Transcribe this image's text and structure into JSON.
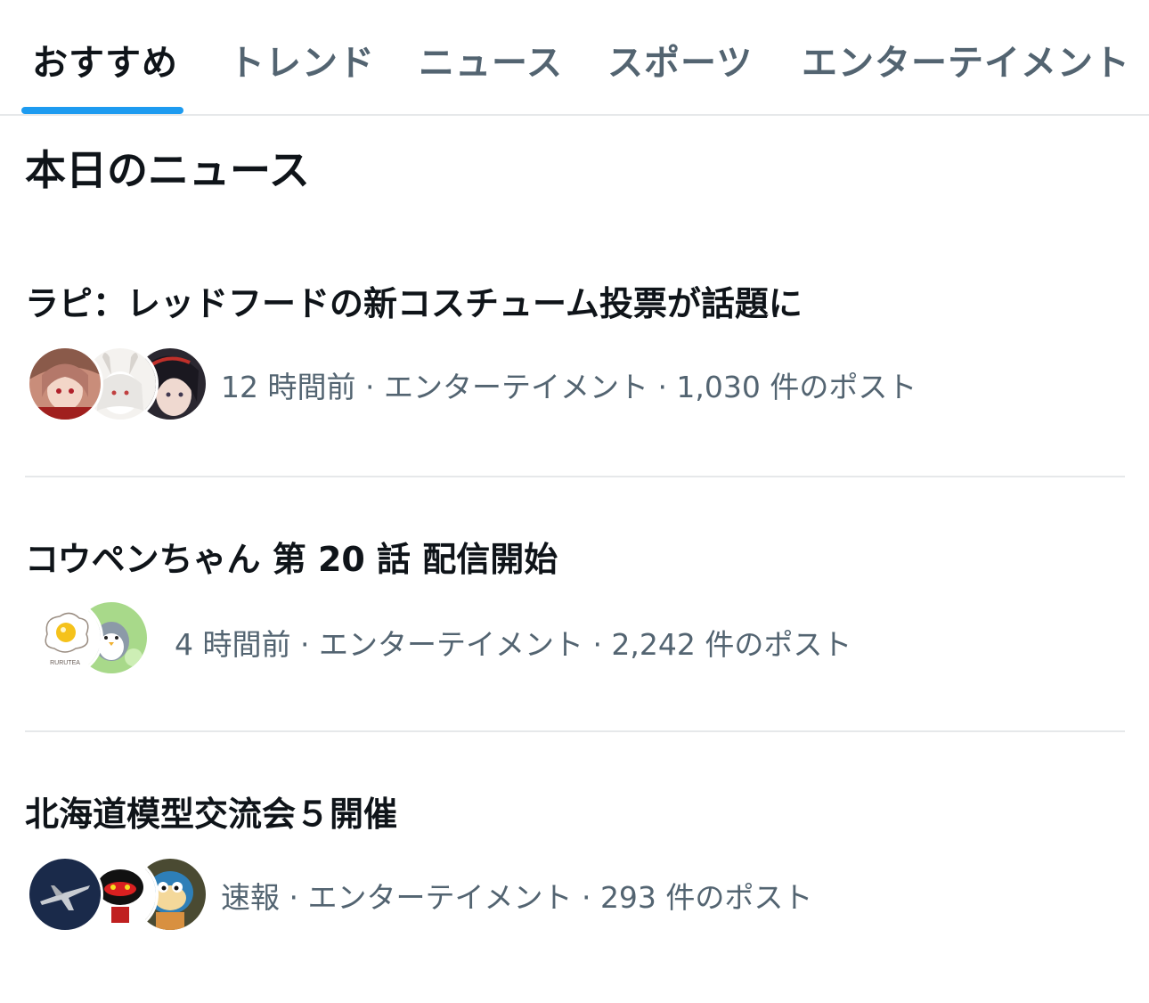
{
  "tabs": [
    {
      "label": "おすすめ"
    },
    {
      "label": "トレンド"
    },
    {
      "label": "ニュース"
    },
    {
      "label": "スポーツ"
    },
    {
      "label": "エンターテイメント"
    }
  ],
  "section_title": "本日のニュース",
  "news": [
    {
      "headline": "ラピ：レッドフードの新コスチューム投票が話題に",
      "meta": "12 時間前 · エンターテイメント · 1,030 件のポスト"
    },
    {
      "headline": "コウペンちゃん 第 20 話 配信開始",
      "meta": "4 時間前 · エンターテイメント · 2,242 件のポスト"
    },
    {
      "headline": "北海道模型交流会５開催",
      "meta": "速報 · エンターテイメント · 293 件のポスト"
    }
  ],
  "avatar_texts": {
    "egg_logo": "RURUTEA"
  },
  "colors": {
    "accent": "#1d9bf0",
    "text_primary": "#0f1419",
    "text_secondary": "#536471",
    "divider": "#e6e8ea"
  }
}
